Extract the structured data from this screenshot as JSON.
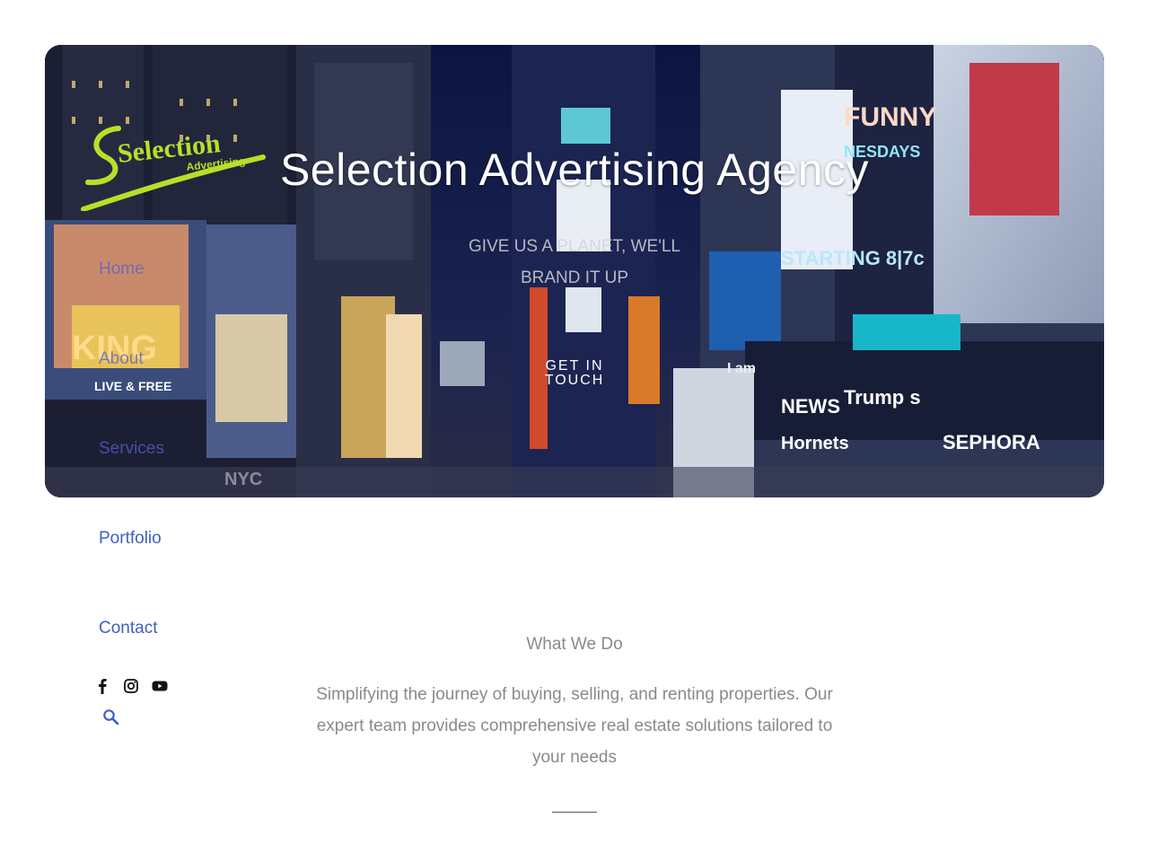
{
  "site": {
    "logo": {
      "name": "Selection",
      "tagline": "Advertising"
    }
  },
  "hero": {
    "title": "Selection Advertising Agency",
    "subtitle": "GIVE US A PLANET, WE'LL BRAND IT UP",
    "cta": "GET IN TOUCH"
  },
  "nav": {
    "items": [
      {
        "label": "Home"
      },
      {
        "label": "About"
      },
      {
        "label": "Services"
      },
      {
        "label": "Portfolio"
      },
      {
        "label": "Contact"
      }
    ]
  },
  "social": {
    "icons": [
      "facebook-icon",
      "instagram-icon",
      "youtube-icon"
    ]
  },
  "what_we_do": {
    "heading": "What We Do",
    "body": "Simplifying the journey of buying, selling, and renting properties. Our expert team provides comprehensive real estate solutions tailored to your needs"
  },
  "colors": {
    "nav_link": "#3d5fc4",
    "text_muted": "#8a8a8a",
    "logo_green": "#b6e028"
  }
}
